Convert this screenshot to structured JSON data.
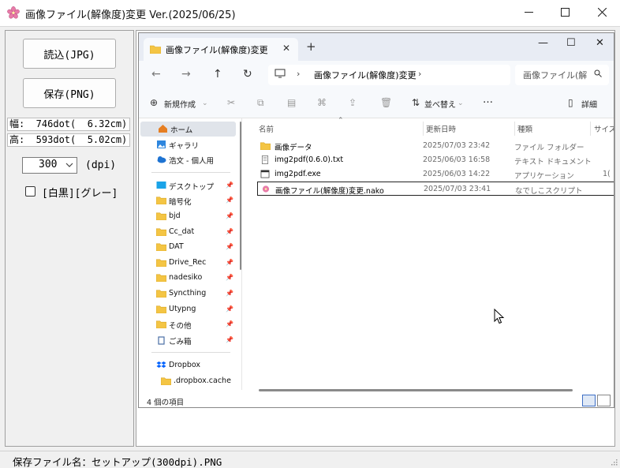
{
  "window": {
    "title": "画像ファイル(解像度)変更 Ver.(2025/06/25)",
    "app_icon": "sakura-flower-icon",
    "controls": [
      "minimize-icon",
      "maximize-icon",
      "close-icon"
    ]
  },
  "left_panel": {
    "load_button": "読込(JPG)",
    "save_button": "保存(PNG)",
    "width_readout": "幅:  746dot(  6.32cm)",
    "height_readout": "高:  593dot(  5.02cm)",
    "dpi_value": "300",
    "dpi_unit": "(dpi)",
    "grayscale_label": "[白黒][グレー]",
    "grayscale_checked": false
  },
  "explorer": {
    "tab_title": "画像ファイル(解像度)変更",
    "address": "画像ファイル(解像度)変更",
    "search_placeholder": "画像ファイル(解",
    "commands": {
      "new": "新規作成",
      "sort": "並べ替え",
      "more": "…",
      "details": "詳細"
    },
    "sidebar": [
      {
        "label": "ホーム",
        "icon": "home-icon",
        "selected": true,
        "pinned": false
      },
      {
        "label": "ギャラリ",
        "icon": "gallery-icon",
        "pinned": false
      },
      {
        "label": "浩文 - 個人用",
        "icon": "cloud-icon",
        "pinned": false
      },
      {
        "label": "デスクトップ",
        "icon": "desktop-icon",
        "pinned": true
      },
      {
        "label": "暗号化",
        "icon": "folder-icon",
        "pinned": true
      },
      {
        "label": "bjd",
        "icon": "folder-icon",
        "pinned": true
      },
      {
        "label": "Cc_dat",
        "icon": "folder-icon",
        "pinned": true
      },
      {
        "label": "DAT",
        "icon": "folder-icon",
        "pinned": true
      },
      {
        "label": "Drive_Rec",
        "icon": "folder-icon",
        "pinned": true
      },
      {
        "label": "nadesiko",
        "icon": "folder-icon",
        "pinned": true
      },
      {
        "label": "Syncthing",
        "icon": "folder-icon",
        "pinned": true
      },
      {
        "label": "Utypng",
        "icon": "folder-icon",
        "pinned": true
      },
      {
        "label": "その他",
        "icon": "folder-icon",
        "pinned": true
      },
      {
        "label": "ごみ箱",
        "icon": "recycle-bin-icon",
        "pinned": true
      },
      {
        "label": "Dropbox",
        "icon": "dropbox-icon",
        "pinned": false
      },
      {
        "label": ".dropbox.cache",
        "icon": "folder-icon",
        "pinned": false
      }
    ],
    "columns": {
      "name": "名前",
      "date": "更新日時",
      "type": "種類",
      "size": "サイズ"
    },
    "files": [
      {
        "name": "画像データ",
        "date": "2025/07/03 23:42",
        "type": "ファイル フォルダー",
        "size": "",
        "icon": "folder-icon"
      },
      {
        "name": "img2pdf(0.6.0).txt",
        "date": "2025/06/03 16:58",
        "type": "テキスト ドキュメント",
        "size": "",
        "icon": "text-file-icon"
      },
      {
        "name": "img2pdf.exe",
        "date": "2025/06/03 14:22",
        "type": "アプリケーション",
        "size": "1(",
        "icon": "exe-icon"
      },
      {
        "name": "画像ファイル(解像度)変更.nako",
        "date": "2025/07/03 23:41",
        "type": "なでしこスクリプト",
        "size": "",
        "icon": "nako-script-icon",
        "selected": true
      }
    ],
    "status": "4 個の項目"
  },
  "statusbar": {
    "text": "保存ファイル名：セットアップ(300dpi).PNG"
  },
  "colors": {
    "folder": "#f4c544",
    "accent": "#3e6fc5",
    "sakura": "#e87aa8"
  }
}
